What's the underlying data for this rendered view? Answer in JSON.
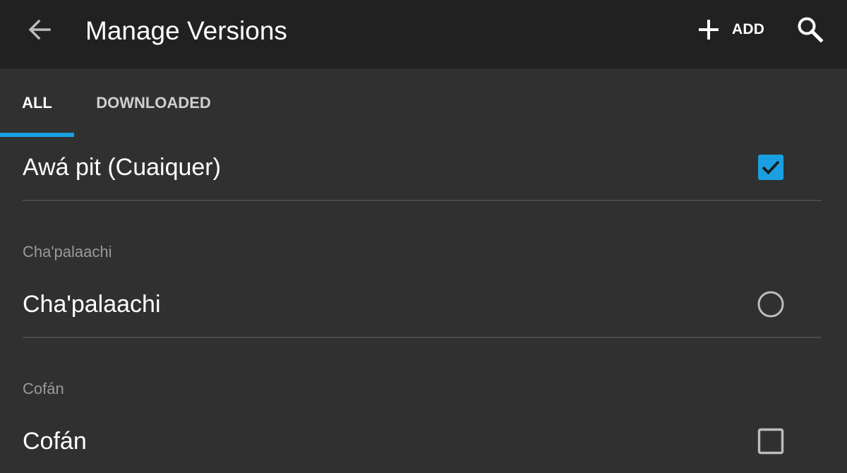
{
  "appbar": {
    "title": "Manage Versions",
    "add_label": "ADD",
    "icons": [
      "back-arrow-icon",
      "plus-icon",
      "search-icon"
    ]
  },
  "tabs": [
    {
      "label": "ALL",
      "selected": true
    },
    {
      "label": "DOWNLOADED",
      "selected": false
    }
  ],
  "list": {
    "rows": [
      {
        "name": "Awá pit (Cuaiquer)",
        "control": "checkbox",
        "checked": true
      },
      {
        "section": "Cha'palaachi",
        "name": "Cha'palaachi",
        "control": "radio",
        "checked": false
      },
      {
        "section": "Cofán",
        "name": "Cofán",
        "control": "checkbox",
        "checked": false
      }
    ]
  },
  "colors": {
    "appbar_bg": "#212121",
    "page_bg": "#303030",
    "accent": "#1a9fe0",
    "divider": "#4a4a4a",
    "section_text": "#9a9a9a"
  }
}
